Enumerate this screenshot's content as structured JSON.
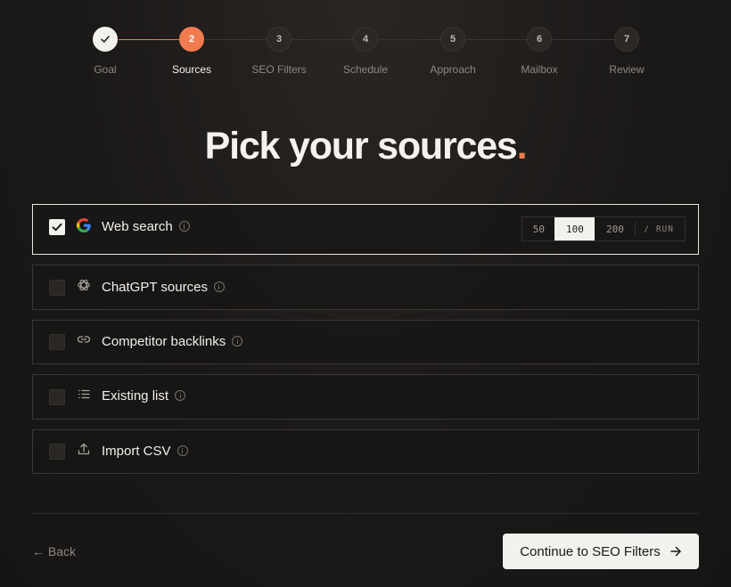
{
  "stepper": {
    "steps": [
      {
        "number": "1",
        "label": "Goal",
        "state": "done"
      },
      {
        "number": "2",
        "label": "Sources",
        "state": "active"
      },
      {
        "number": "3",
        "label": "SEO Filters",
        "state": "upcoming"
      },
      {
        "number": "4",
        "label": "Schedule",
        "state": "upcoming"
      },
      {
        "number": "5",
        "label": "Approach",
        "state": "upcoming"
      },
      {
        "number": "6",
        "label": "Mailbox",
        "state": "upcoming"
      },
      {
        "number": "7",
        "label": "Review",
        "state": "upcoming"
      }
    ]
  },
  "heading": {
    "text": "Pick your sources",
    "dot": "."
  },
  "sources": [
    {
      "label": "Web search",
      "icon": "google-icon",
      "checked": true
    },
    {
      "label": "ChatGPT sources",
      "icon": "openai-icon",
      "checked": false
    },
    {
      "label": "Competitor backlinks",
      "icon": "link-icon",
      "checked": false
    },
    {
      "label": "Existing list",
      "icon": "list-icon",
      "checked": false
    },
    {
      "label": "Import CSV",
      "icon": "upload-icon",
      "checked": false
    }
  ],
  "results_per_run": {
    "options": [
      "50",
      "100",
      "200"
    ],
    "selected": "100",
    "unit": "/ RUN"
  },
  "footer": {
    "back_label": "← Back",
    "continue_label": "Continue to SEO Filters"
  },
  "colors": {
    "accent": "#f07b50",
    "background": "#1b1918",
    "button_bg": "#f3f1ee"
  }
}
